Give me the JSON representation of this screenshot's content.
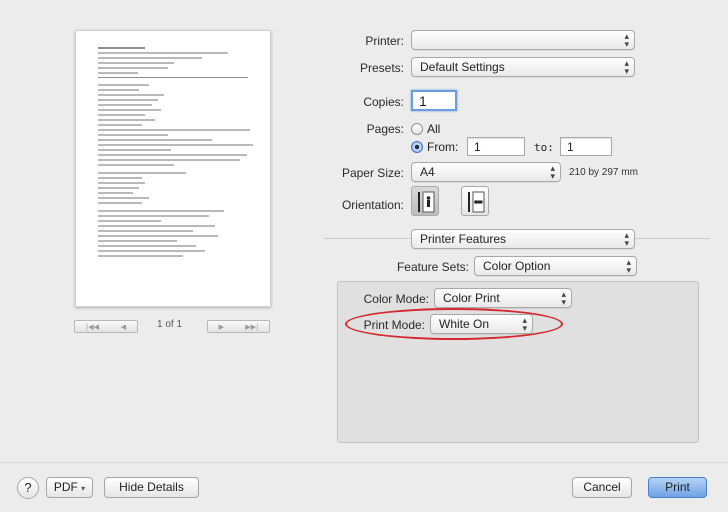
{
  "preview": {
    "page_indicator": "1 of 1",
    "nav": {
      "first": "|◀◀",
      "prev": "◀",
      "next": "▶",
      "last": "▶▶|"
    }
  },
  "printer": {
    "label": "Printer:",
    "value": ""
  },
  "presets": {
    "label": "Presets:",
    "value": "Default Settings"
  },
  "copies": {
    "label": "Copies:",
    "value": "1"
  },
  "pages": {
    "label": "Pages:",
    "all_label": "All",
    "from_label": "From:",
    "from_value": "1",
    "to_label": "to:",
    "to_value": "1",
    "selected": "from"
  },
  "paper_size": {
    "label": "Paper Size:",
    "value": "A4",
    "dimensions": "210 by 297 mm"
  },
  "orientation": {
    "label": "Orientation:",
    "selected": "portrait"
  },
  "section": {
    "value": "Printer Features"
  },
  "feature_sets": {
    "label": "Feature Sets:",
    "value": "Color Option"
  },
  "color_mode": {
    "label": "Color Mode:",
    "value": "Color Print"
  },
  "print_mode": {
    "label": "Print Mode:",
    "value": "White On"
  },
  "highlight_color": "#d3282d",
  "footer": {
    "help_label": "?",
    "pdf_label": "PDF",
    "hide_details_label": "Hide Details",
    "cancel_label": "Cancel",
    "print_label": "Print"
  },
  "icons": {
    "popup": "up-down-arrows-icon",
    "pdf_menu": "chevron-down-icon",
    "portrait": "portrait-orientation-icon",
    "landscape": "landscape-orientation-icon"
  }
}
